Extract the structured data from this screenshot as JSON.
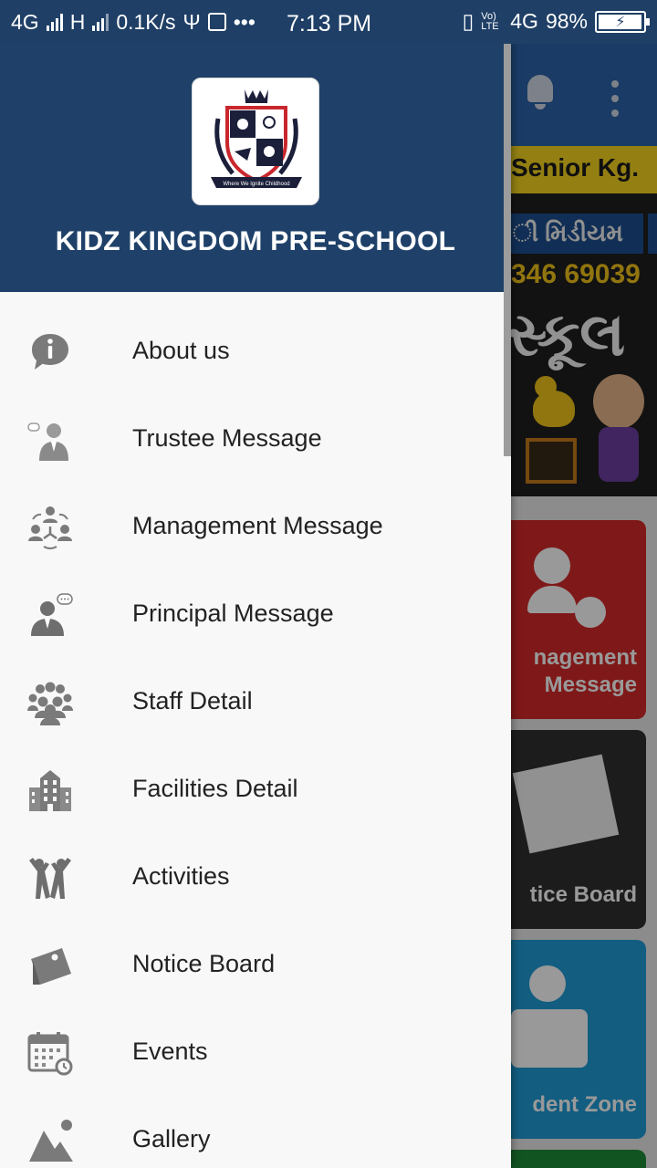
{
  "status_bar": {
    "network_left": "4G",
    "network_h": "H",
    "speed": "0.1K/s",
    "time": "7:13 PM",
    "volte": "Vo) LTE",
    "network_right": "4G",
    "sim": "1",
    "battery": "98%",
    "icons": [
      "signal-icon",
      "usb-icon",
      "app-notification-icon",
      "more-dots-icon",
      "vibrate-icon",
      "battery-icon"
    ]
  },
  "drawer": {
    "school_name": "KIDZ KINGDOM PRE-SCHOOL",
    "logo_banner": "Where We Ignite Childhood",
    "menu": [
      {
        "label": "About us",
        "icon": "info-icon"
      },
      {
        "label": "Trustee Message",
        "icon": "trustee-icon"
      },
      {
        "label": "Management Message",
        "icon": "management-icon"
      },
      {
        "label": "Principal Message",
        "icon": "principal-icon"
      },
      {
        "label": "Staff Detail",
        "icon": "staff-icon"
      },
      {
        "label": "Facilities Detail",
        "icon": "building-icon"
      },
      {
        "label": "Activities",
        "icon": "activities-icon"
      },
      {
        "label": "Notice Board",
        "icon": "notice-board-icon"
      },
      {
        "label": "Events",
        "icon": "calendar-icon"
      },
      {
        "label": "Gallery",
        "icon": "gallery-icon"
      }
    ]
  },
  "background": {
    "banner_senior": "Senior Kg.",
    "banner_medium": "ી મિડીયમ",
    "banner_phone": "346 69039",
    "banner_school": "સ્કૂલ",
    "tiles": [
      {
        "label": "nagement\nMessage"
      },
      {
        "label": "tice Board"
      },
      {
        "label": "dent Zone"
      }
    ],
    "icons": [
      "bell-icon",
      "overflow-menu-icon"
    ]
  },
  "colors": {
    "header_bg": "#1f4169",
    "status_bg": "#1f3f66",
    "drawer_bg": "#f8f8f8",
    "label": "#222222",
    "icon": "#7a7a7a"
  }
}
